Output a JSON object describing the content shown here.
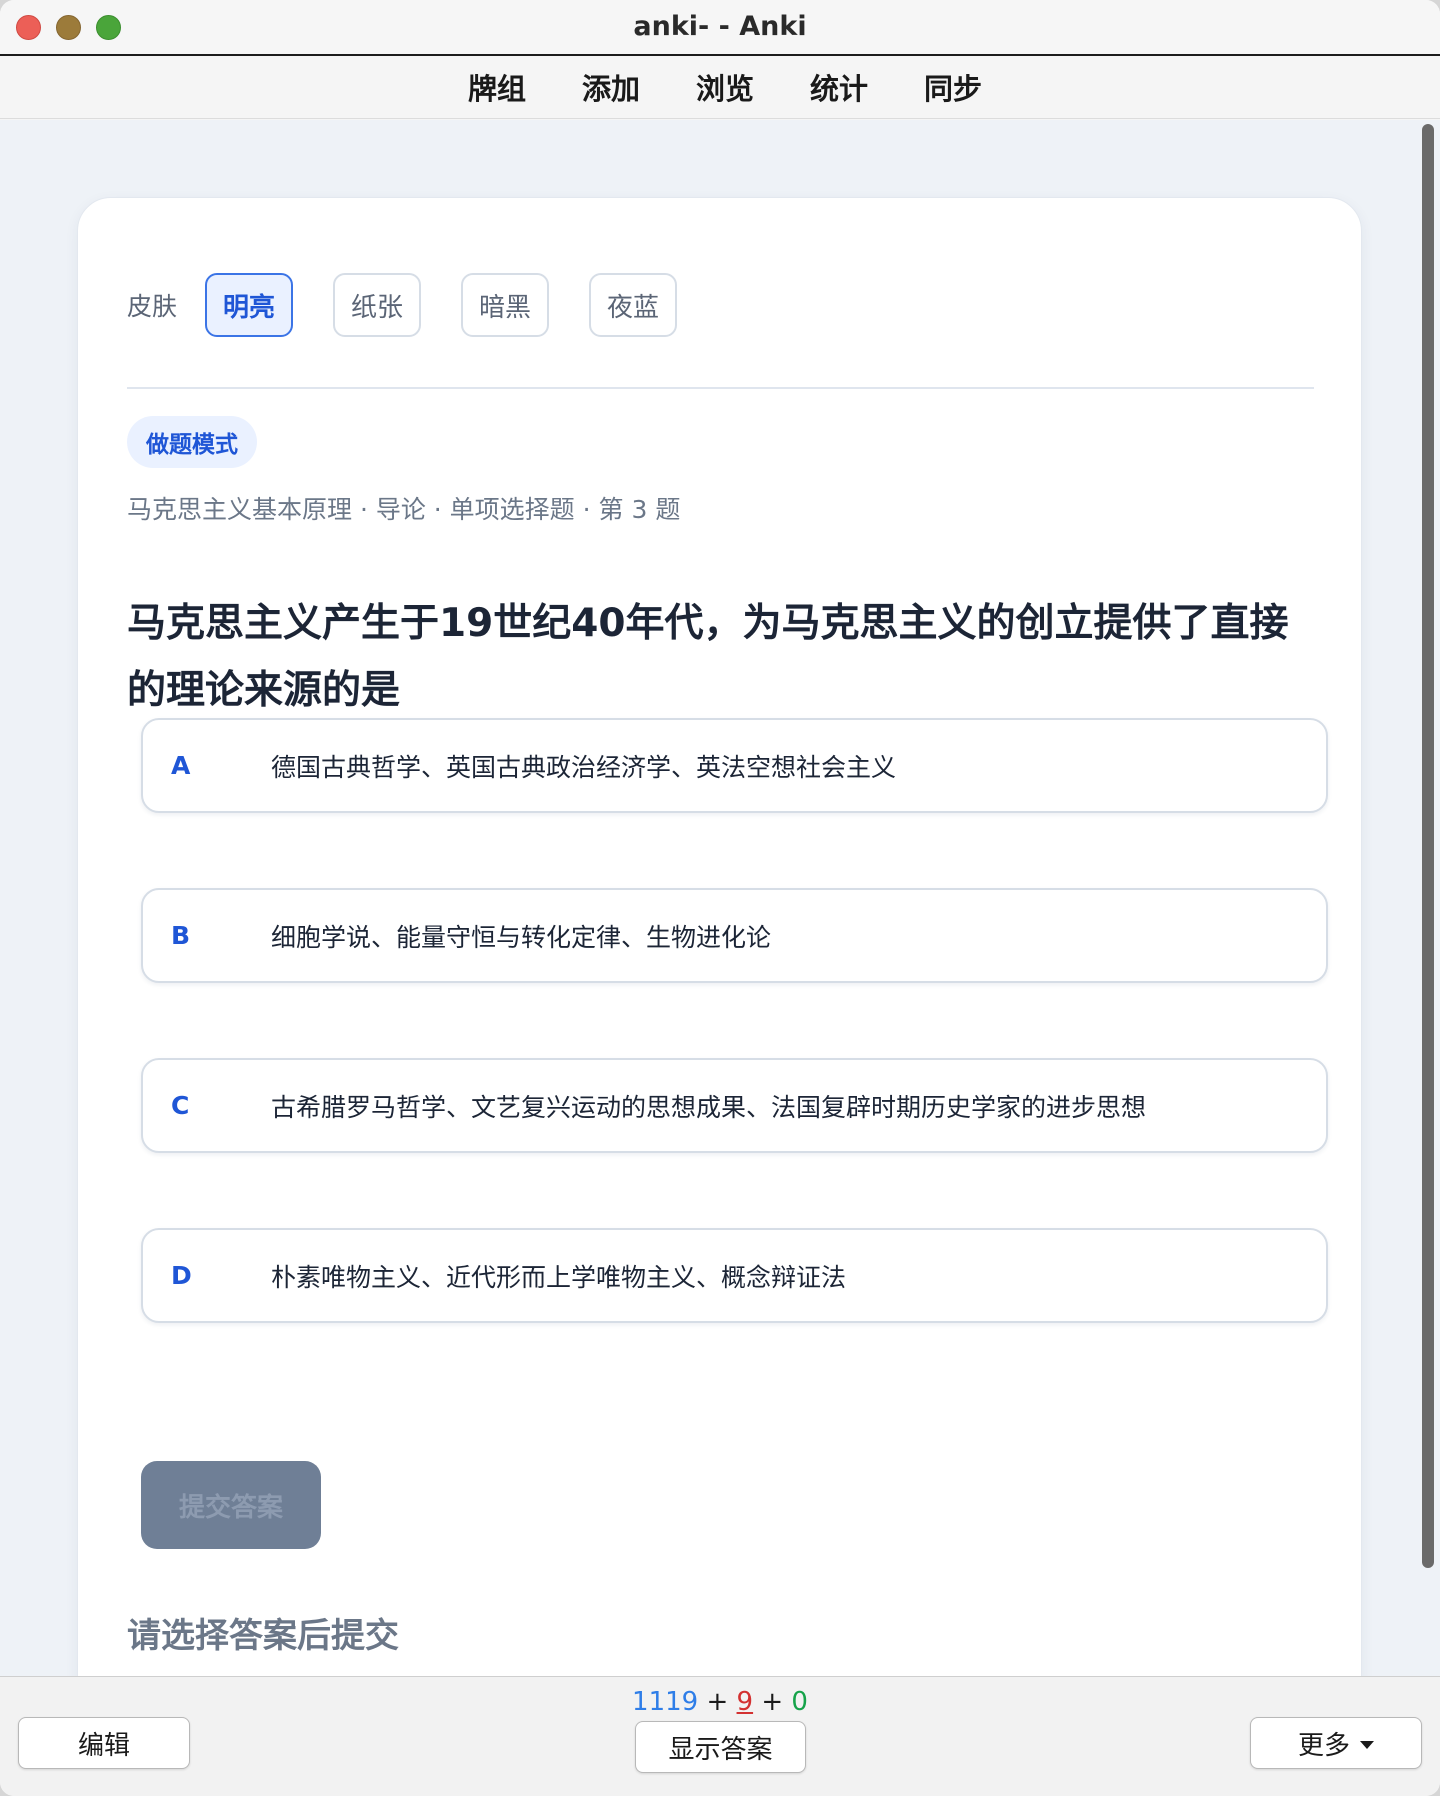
{
  "window": {
    "title": "anki- - Anki"
  },
  "toolbar": {
    "items": [
      "牌组",
      "添加",
      "浏览",
      "统计",
      "同步"
    ]
  },
  "card": {
    "skin_label": "皮肤",
    "skins": [
      {
        "label": "明亮",
        "active": true
      },
      {
        "label": "纸张",
        "active": false
      },
      {
        "label": "暗黑",
        "active": false
      },
      {
        "label": "夜蓝",
        "active": false
      }
    ],
    "mode_badge": "做题模式",
    "meta": "马克思主义基本原理 · 导论 · 单项选择题 · 第 3 题",
    "question": "马克思主义产生于19世纪40年代，为马克思主义的创立提供了直接的理论来源的是",
    "options": [
      {
        "letter": "A",
        "text": "德国古典哲学、英国古典政治经济学、英法空想社会主义"
      },
      {
        "letter": "B",
        "text": "细胞学说、能量守恒与转化定律、生物进化论"
      },
      {
        "letter": "C",
        "text": "古希腊罗马哲学、文艺复兴运动的思想成果、法国复辟时期历史学家的进步思想"
      },
      {
        "letter": "D",
        "text": "朴素唯物主义、近代形而上学唯物主义、概念辩证法"
      }
    ],
    "submit_label": "提交答案",
    "hint": "请选择答案后提交"
  },
  "bottom": {
    "counts": {
      "new": "1119",
      "learn": "9",
      "review": "0",
      "sep": "+"
    },
    "edit_label": "编辑",
    "show_answer_label": "显示答案",
    "more_label": "更多"
  },
  "colors": {
    "accent": "#1f56d6",
    "new": "#2f7ee8",
    "learn": "#d33131",
    "review": "#16a34a"
  }
}
